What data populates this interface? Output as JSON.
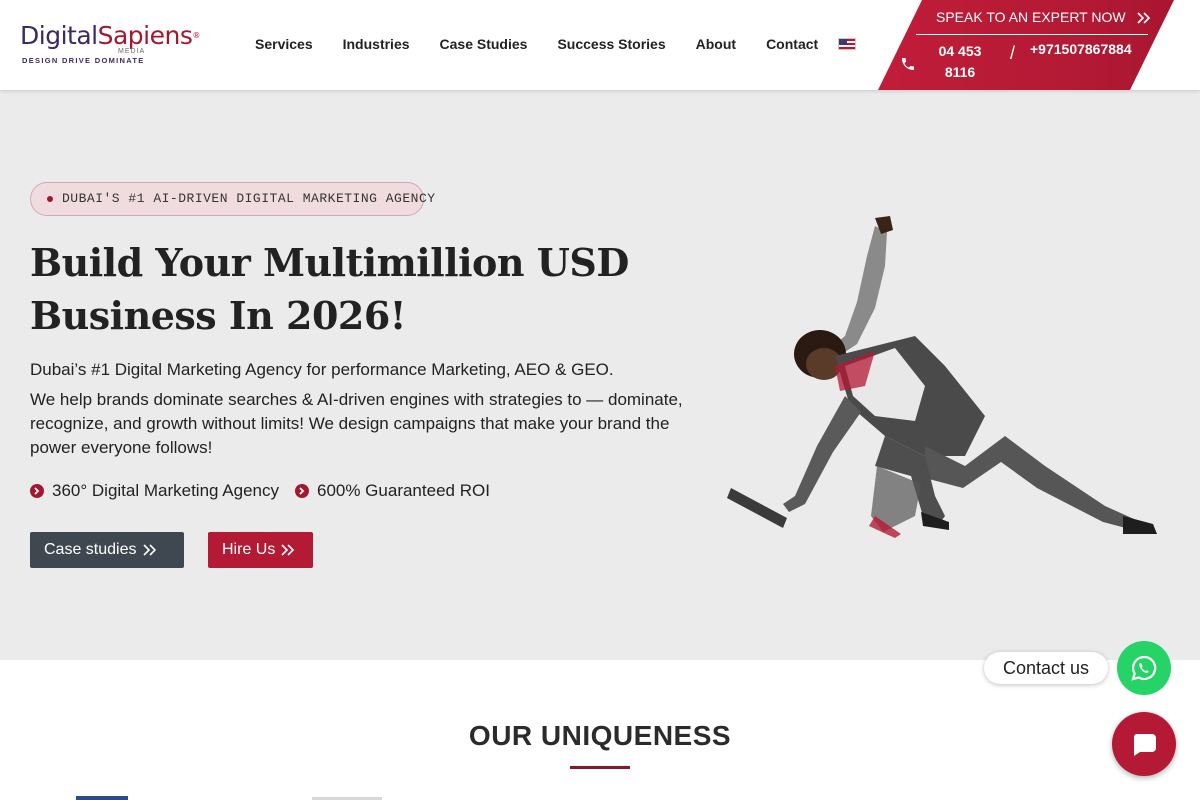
{
  "brand": {
    "logo_part1": "Digital",
    "logo_part2": "Sapiens",
    "logo_reg": "®",
    "logo_media": "MEDIA",
    "logo_tagline": "DESIGN DRIVE DOMINATE",
    "colors": {
      "primary_red": "#b51a35",
      "purple": "#3c2a63",
      "dark_button": "#3f4850",
      "whatsapp_green": "#25d366"
    }
  },
  "nav": {
    "items": [
      {
        "label": "Services"
      },
      {
        "label": "Industries"
      },
      {
        "label": "Case Studies"
      },
      {
        "label": "Success Stories"
      },
      {
        "label": "About"
      },
      {
        "label": "Contact"
      }
    ],
    "language_icon": "us-flag-icon"
  },
  "cta": {
    "speak_label": "SPEAK TO AN EXPERT NOW",
    "phone_icon": "phone-icon",
    "phone1": "04 453 8116",
    "separator": "/",
    "phone2": "+971507867884"
  },
  "hero": {
    "badge": "DUBAI'S #1 AI-DRIVEN DIGITAL MARKETING AGENCY",
    "title_line1": "Build Your Multimillion USD",
    "title_line2": "Business In 2026!",
    "lead": "Dubai’s #1 Digital Marketing Agency for performance Marketing, AEO & GEO.",
    "description": "We help brands dominate searches & AI-driven engines with strategies to — dominate, recognize, and growth without limits! We design campaigns that make your brand the power everyone follows!",
    "features": [
      {
        "label": "360° Digital Marketing Agency",
        "icon": "chevron-circle-icon"
      },
      {
        "label": "600% Guaranteed ROI",
        "icon": "chevron-circle-icon"
      }
    ],
    "buttons": {
      "case_studies": "Case studies",
      "hire_us": "Hire Us"
    }
  },
  "uniqueness": {
    "title": "OUR UNIQUENESS"
  },
  "chat": {
    "contact_label": "Contact us"
  }
}
